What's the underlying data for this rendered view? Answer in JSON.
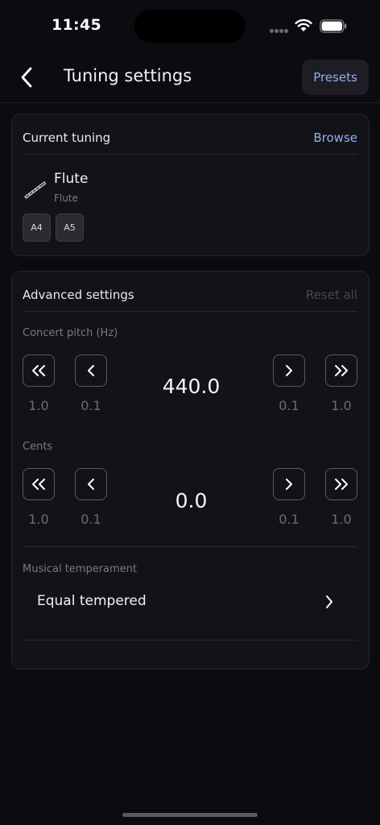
{
  "status_bar": {
    "time": "11:45"
  },
  "header": {
    "title": "Tuning settings",
    "presets_label": "Presets"
  },
  "current_tuning": {
    "title": "Current tuning",
    "browse_label": "Browse",
    "instrument_name": "Flute",
    "instrument_sub": "Flute",
    "notes": [
      "A4",
      "A5"
    ]
  },
  "advanced": {
    "title": "Advanced settings",
    "reset_label": "Reset all",
    "concert_pitch": {
      "label": "Concert pitch (Hz)",
      "value": "440.0",
      "steps": [
        "1.0",
        "0.1",
        "0.1",
        "1.0"
      ]
    },
    "cents": {
      "label": "Cents",
      "value": "0.0",
      "steps": [
        "1.0",
        "0.1",
        "0.1",
        "1.0"
      ]
    },
    "temperament": {
      "label": "Musical temperament",
      "value": "Equal tempered"
    }
  },
  "colors": {
    "accent": "#8eb1ee",
    "background": "#0c0b10",
    "card": "#131217"
  }
}
